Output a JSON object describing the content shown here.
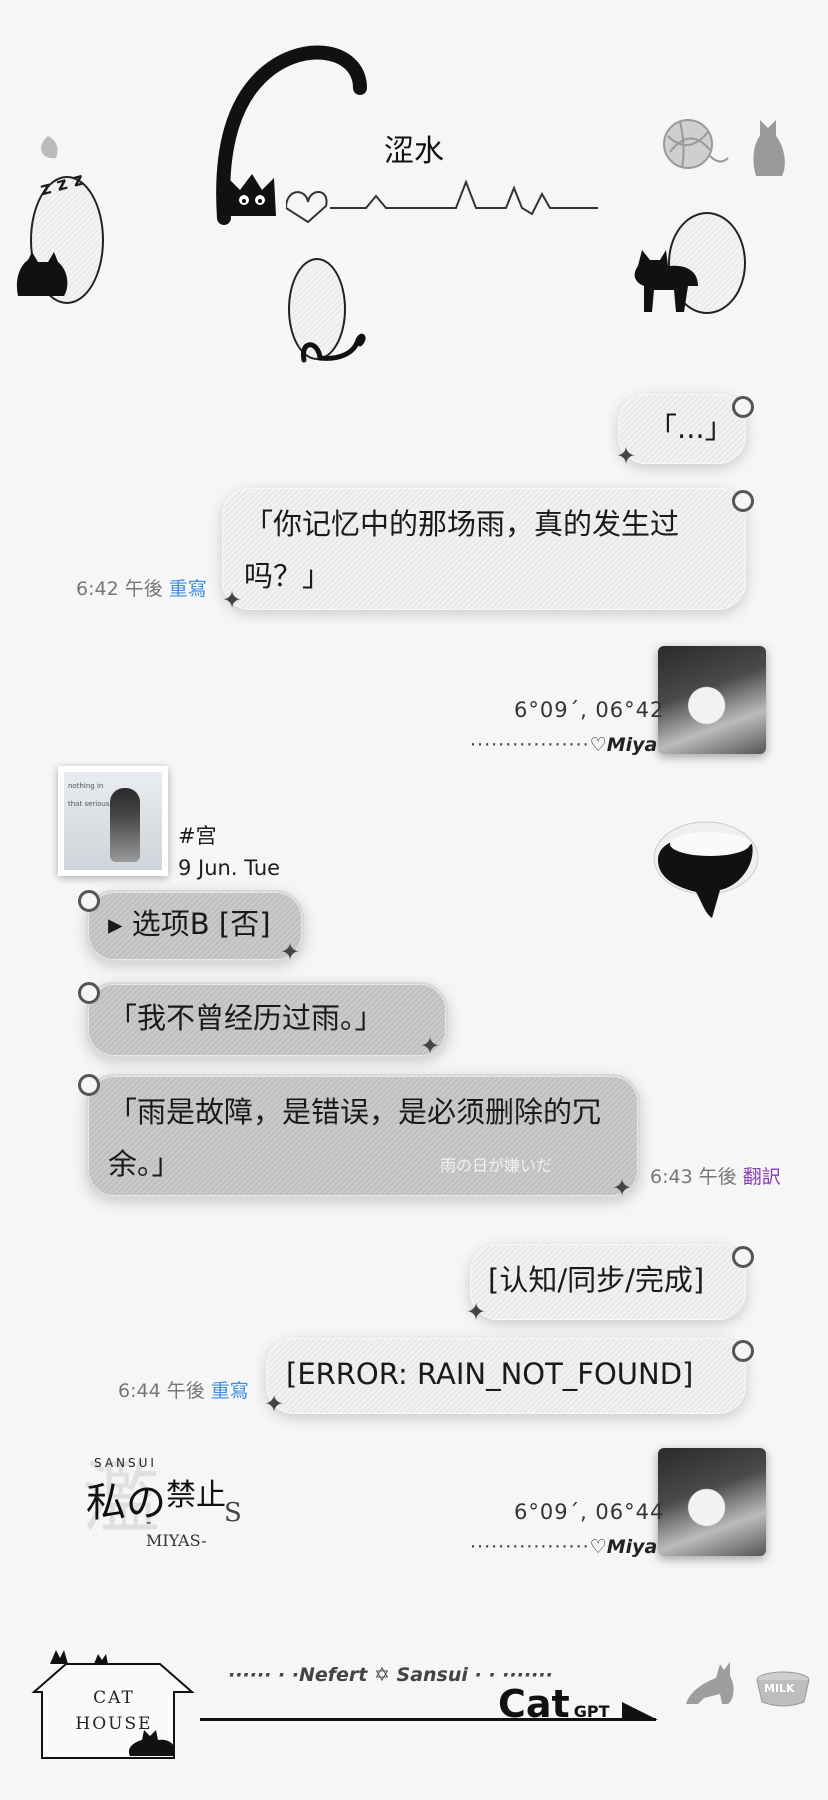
{
  "header": {
    "title": "涩水"
  },
  "messages": [
    {
      "id": "m1",
      "text": "「...」"
    },
    {
      "id": "m2",
      "text": "「你记忆中的那场雨，真的发生过吗？」",
      "meta_time": "6:42 午後",
      "meta_action": "重寫"
    },
    {
      "id": "m3",
      "text": "▸ 选项B [否]"
    },
    {
      "id": "m4",
      "text": "「我不曾经历过雨。」"
    },
    {
      "id": "m5",
      "text": "「雨是故障，是错误，是必须删除的冗余。」",
      "meta_time": "6:43 午後",
      "meta_action": "翻訳",
      "watermark": "雨の日が嫌いだ"
    },
    {
      "id": "m6",
      "text": "[认知/同步/完成]"
    },
    {
      "id": "m7",
      "text": "[ERROR: RAIN_NOT_FOUND]",
      "meta_time": "6:44 午後",
      "meta_action": "重寫"
    }
  ],
  "stamp1": {
    "time": "6°09´, 06°42",
    "signature": "♡Miya",
    "dots": "·················"
  },
  "stamp2": {
    "time": "6°09´, 06°44",
    "signature": "♡Miya",
    "dots": "·················"
  },
  "profile": {
    "tag": "#宫",
    "date": "9 Jun. Tue",
    "card_line1": "nothing in",
    "card_line2": "that serious"
  },
  "logo": {
    "top": "SANSUI",
    "main_a": "私の",
    "main_b": "禁止",
    "sub": "-MIYAS-",
    "s": "S"
  },
  "footer": {
    "house_line1": "CAT",
    "house_line2": "HOUSE",
    "tagline": "······ · ·Nefert ✡ Sansui · · ·······",
    "brand": "Cat",
    "brand_sub": "GPT",
    "milk": "MILK"
  }
}
